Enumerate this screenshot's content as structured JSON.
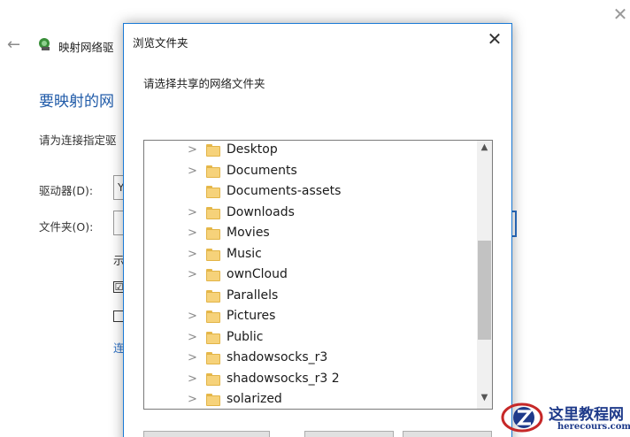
{
  "wizard": {
    "title": "映射网络驱",
    "heading": "要映射的网",
    "description": "请为连接指定驱",
    "drive_label": "驱动器(D):",
    "drive_value": "Y",
    "folder_label": "文件夹(O):",
    "example_stub": "示",
    "checkbox1_mark": "☑",
    "checkbox2_mark": "",
    "link_stub": "连",
    "close_glyph": "✕",
    "back_glyph": "←"
  },
  "dialog": {
    "title": "浏览文件夹",
    "close_glyph": "✕",
    "prompt": "请选择共享的网络文件夹",
    "folders": [
      {
        "name": "Desktop",
        "expandable": true
      },
      {
        "name": "Documents",
        "expandable": true
      },
      {
        "name": "Documents-assets",
        "expandable": false
      },
      {
        "name": "Downloads",
        "expandable": true
      },
      {
        "name": "Movies",
        "expandable": true
      },
      {
        "name": "Music",
        "expandable": true
      },
      {
        "name": "ownCloud",
        "expandable": true
      },
      {
        "name": "Parallels",
        "expandable": false
      },
      {
        "name": "Pictures",
        "expandable": true
      },
      {
        "name": "Public",
        "expandable": true
      },
      {
        "name": "shadowsocks_r3",
        "expandable": true
      },
      {
        "name": "shadowsocks_r3 2",
        "expandable": true
      },
      {
        "name": "solarized",
        "expandable": true
      }
    ],
    "highlighted_folder": "Pictures",
    "buttons": [
      "",
      "",
      ""
    ]
  },
  "watermark": {
    "name": "这里教程网",
    "url": "herecours.com"
  },
  "colors": {
    "accent": "#1a7ad6",
    "highlight": "#e03a4e",
    "heading": "#1f5aa8",
    "folder": "#f6d27a"
  }
}
